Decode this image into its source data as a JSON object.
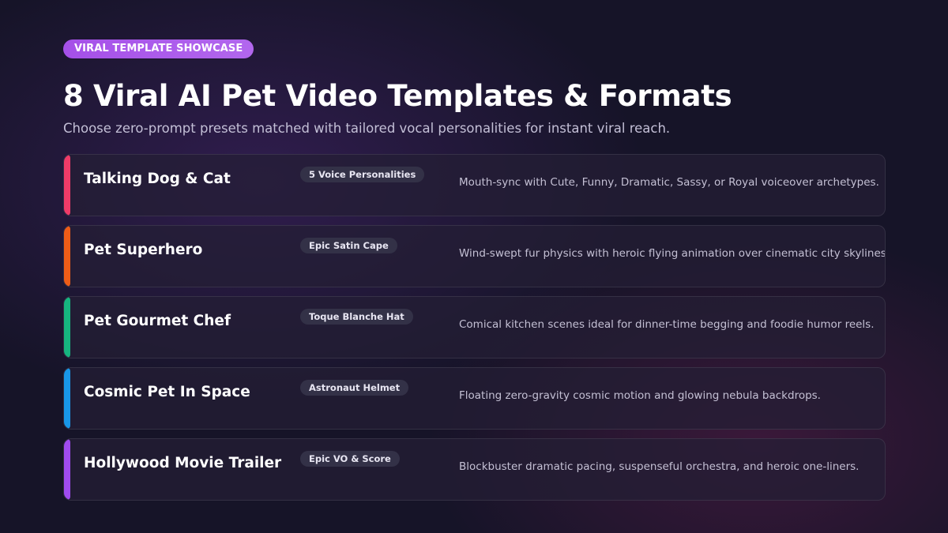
{
  "badge": "VIRAL TEMPLATE SHOWCASE",
  "title": "8 Viral AI Pet Video Templates & Formats",
  "subtitle": "Choose zero-prompt presets matched with tailored vocal personalities for instant viral reach.",
  "templates": [
    {
      "title": "Talking Dog & Cat",
      "tag": "5 Voice Personalities",
      "description": "Mouth-sync with Cute, Funny, Dramatic, Sassy, or Royal voiceover archetypes.",
      "accent": "#ef3b68"
    },
    {
      "title": "Pet Superhero",
      "tag": "Epic Satin Cape",
      "description": "Wind-swept fur physics with heroic flying animation over cinematic city skylines.",
      "accent": "#ee5c17"
    },
    {
      "title": "Pet Gourmet Chef",
      "tag": "Toque Blanche Hat",
      "description": "Comical kitchen scenes ideal for dinner-time begging and foodie humor reels.",
      "accent": "#16b57f"
    },
    {
      "title": "Cosmic Pet In Space",
      "tag": "Astronaut Helmet",
      "description": "Floating zero-gravity cosmic motion and glowing nebula backdrops.",
      "accent": "#1897e8"
    },
    {
      "title": "Hollywood Movie Trailer",
      "tag": "Epic VO & Score",
      "description": "Blockbuster dramatic pacing, suspenseful orchestra, and heroic one-liners.",
      "accent": "#a04bef"
    }
  ]
}
